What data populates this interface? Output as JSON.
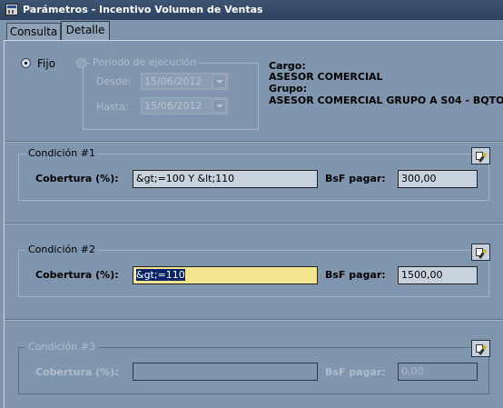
{
  "window": {
    "title": "Parámetros - Incentivo Volumen de Ventas"
  },
  "tabs": [
    {
      "label": "Consulta"
    },
    {
      "label": "Detalle"
    }
  ],
  "period": {
    "fijo_label": "Fijo",
    "periodo_label": "Período de ejecución",
    "desde_label": "Desde:",
    "desde_value": "15/06/2012",
    "hasta_label": "Hasta:",
    "hasta_value": "15/06/2012"
  },
  "info": {
    "cargo_label": "Cargo:",
    "cargo_value": "ASESOR COMERCIAL",
    "grupo_label": "Grupo:",
    "grupo_value": "ASESOR COMERCIAL GRUPO A S04 - BQTO"
  },
  "conditions": [
    {
      "title": "Condición #1",
      "cobertura_label": "Cobertura (%):",
      "cobertura_value": "&gt;=100 Y &lt;110",
      "bsf_label": "BsF pagar:",
      "bsf_value": "300,00"
    },
    {
      "title": "Condición #2",
      "cobertura_label": "Cobertura (%):",
      "cobertura_value": "&gt;=110",
      "bsf_label": "BsF pagar:",
      "bsf_value": "1500,00"
    },
    {
      "title": "Condición #3",
      "cobertura_label": "Cobertura (%):",
      "cobertura_value": "",
      "bsf_label": "BsF pagar:",
      "bsf_value": "0,00"
    }
  ]
}
